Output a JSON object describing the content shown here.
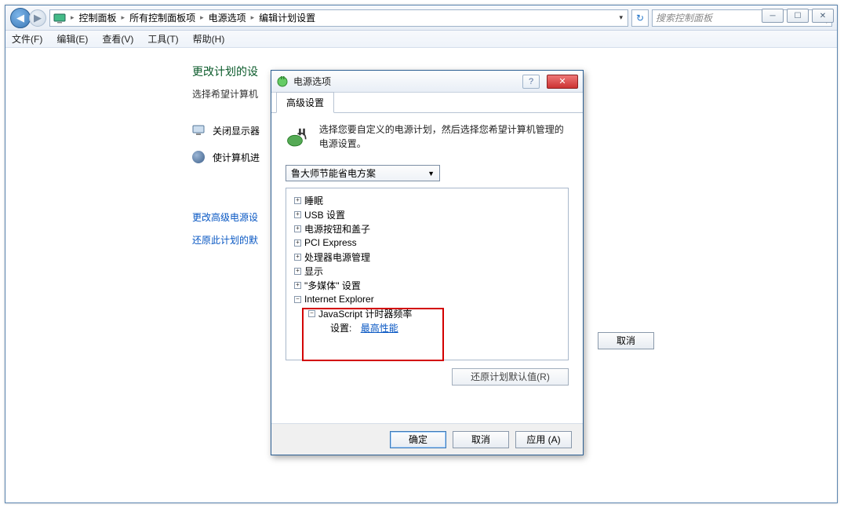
{
  "winbtns": {
    "min": "─",
    "max": "☐",
    "close": "✕"
  },
  "breadcrumb": [
    "控制面板",
    "所有控制面板项",
    "电源选项",
    "编辑计划设置"
  ],
  "search_placeholder": "搜索控制面板",
  "menus": {
    "file": "文件(F)",
    "edit": "编辑(E)",
    "view": "查看(V)",
    "tools": "工具(T)",
    "help": "帮助(H)"
  },
  "page": {
    "title": "更改计划的设",
    "subtitle": "选择希望计算机",
    "row1": "关闭显示器",
    "row2": "使计算机进",
    "link1": "更改高级电源设",
    "link2": "还原此计划的默",
    "cancel": "取消"
  },
  "dialog": {
    "title": "电源选项",
    "tab": "高级设置",
    "intro": "选择您要自定义的电源计划，然后选择您希望计算机管理的电源设置。",
    "plan": "鲁大师节能省电方案",
    "tree": {
      "n0": "睡眠",
      "n1": "USB 设置",
      "n2": "电源按钮和盖子",
      "n3": "PCI Express",
      "n4": "处理器电源管理",
      "n5": "显示",
      "n6": "\"多媒体\" 设置",
      "n7": "Internet Explorer",
      "n7a": "JavaScript 计时器频率",
      "setting_label": "设置:",
      "setting_value": "最高性能"
    },
    "restore": "还原计划默认值(R)",
    "ok": "确定",
    "cancel": "取消",
    "apply": "应用 (A)"
  }
}
